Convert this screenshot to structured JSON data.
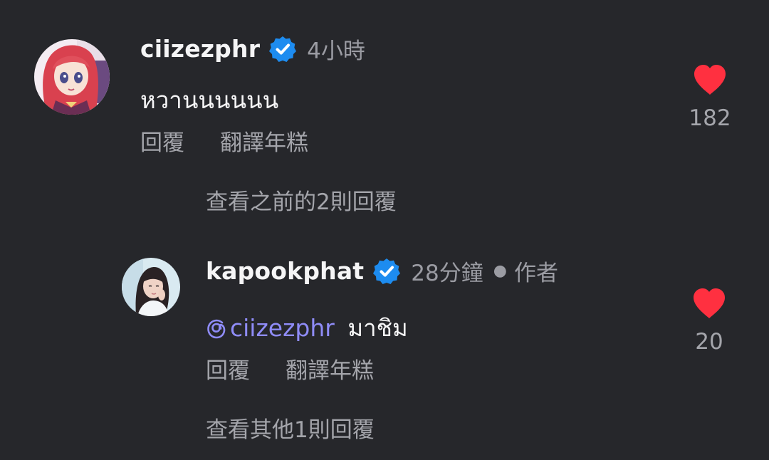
{
  "comments": [
    {
      "username": "ciizezphr",
      "time": "4小時",
      "text": "หวานนนนนน",
      "actions": {
        "reply": "回覆",
        "translate": "翻譯年糕"
      },
      "likes": "182",
      "view_replies": "查看之前的2則回覆",
      "avatar": "anime-girl-avatar",
      "liked": true
    },
    {
      "username": "kapookphat",
      "time": "28分鐘",
      "author_badge": "作者",
      "mention": "ciizezphr",
      "text": "มาชิม",
      "actions": {
        "reply": "回覆",
        "translate": "翻譯年糕"
      },
      "likes": "20",
      "view_replies": "查看其他1則回覆",
      "avatar": "photo-avatar",
      "liked": true
    }
  ],
  "colors": {
    "background": "#26272b",
    "verified": "#1d8cf0",
    "heart": "#ff3040",
    "mention": "#8f8cf8",
    "secondary_text": "#9b9ca3"
  }
}
